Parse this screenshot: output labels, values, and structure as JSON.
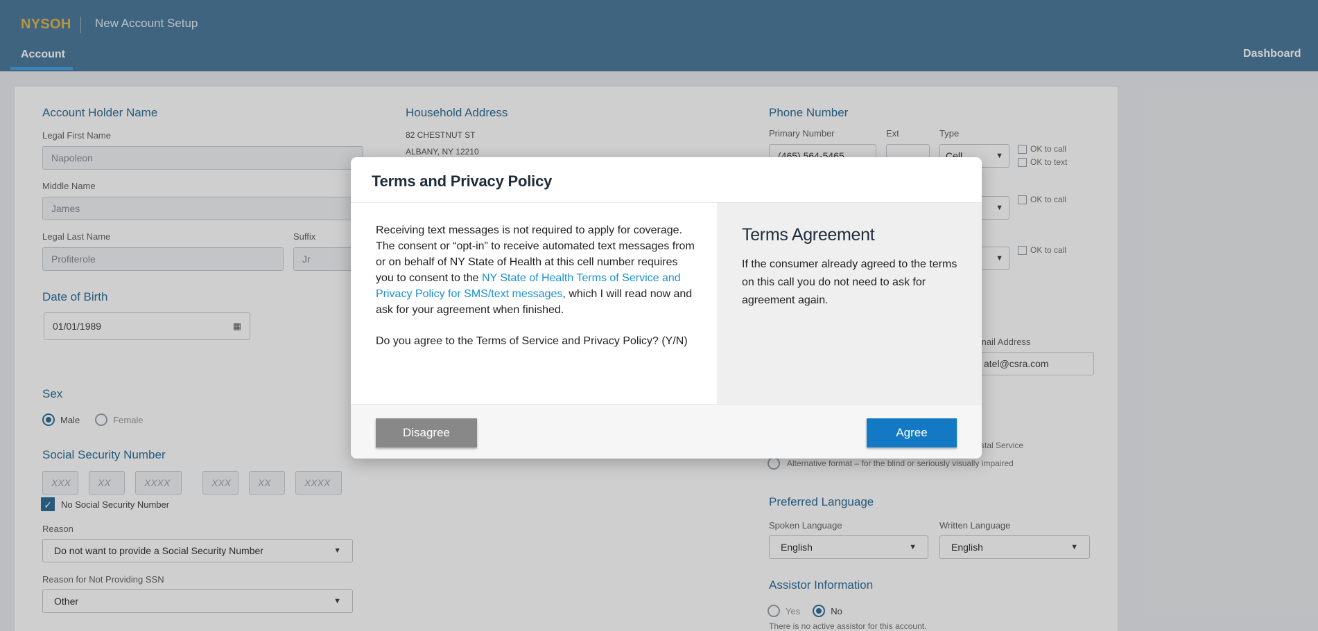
{
  "header": {
    "brand": "NYSOH",
    "title": "New Account Setup",
    "nav_account": "Account",
    "nav_dashboard": "Dashboard"
  },
  "account_holder": {
    "title": "Account Holder Name",
    "first_label": "Legal First Name",
    "first_value": "Napoleon",
    "middle_label": "Middle Name",
    "middle_value": "James",
    "last_label": "Legal Last Name",
    "last_value": "Profiterole",
    "suffix_label": "Suffix",
    "suffix_value": "Jr"
  },
  "dob": {
    "title": "Date of Birth",
    "value": "01/01/1989"
  },
  "sex": {
    "title": "Sex",
    "male": "Male",
    "female": "Female"
  },
  "ssn": {
    "title": "Social Security Number",
    "ph1": "XXX",
    "ph2": "XX",
    "ph3": "XXXX",
    "ph4": "XXX",
    "ph5": "XX",
    "ph6": "XXXX",
    "no_ssn_label": "No Social Security Number",
    "reason_label": "Reason",
    "reason_value": "Do not want to provide a Social Security Number",
    "reason2_label": "Reason for Not Providing SSN",
    "reason2_value": "Other"
  },
  "address": {
    "title": "Household Address",
    "line1": "82 CHESTNUT ST",
    "line2": "ALBANY, NY 12210"
  },
  "phone": {
    "title": "Phone Number",
    "primary_label": "Primary Number",
    "ext_label": "Ext",
    "type_label": "Type",
    "primary_value": "(465) 564-5465",
    "type_value": "Cell",
    "ok_call": "OK to call",
    "ok_text": "OK to text"
  },
  "email": {
    "label": "mail Address",
    "value": "atel@csra.com"
  },
  "notices": {
    "postal_partial": "stal Service",
    "alt_format": "Alternative format – for the blind or seriously visually impaired"
  },
  "language": {
    "title": "Preferred Language",
    "spoken_label": "Spoken Language",
    "spoken_value": "English",
    "written_label": "Written Language",
    "written_value": "English"
  },
  "assistor": {
    "title": "Assistor Information",
    "yes": "Yes",
    "no": "No",
    "note": "There is no active assistor for this account."
  },
  "modal": {
    "title": "Terms and Privacy Policy",
    "body_part1": "Receiving text messages is not required to apply for coverage. The consent or “opt-in” to receive automated text messages from or on behalf of NY State of Health at this cell number requires you to consent to the ",
    "body_link": "NY State of Health Terms of Service and Privacy Policy for SMS/text messages",
    "body_part2": ", which I will read now and ask for your agreement when finished.",
    "question": "Do you agree to the Terms of Service and Privacy Policy? (Y/N)",
    "terms_title": "Terms Agreement",
    "terms_text": "If the consumer already agreed to the terms on this call you do not need to ask for agreement again.",
    "disagree": "Disagree",
    "agree": "Agree"
  }
}
